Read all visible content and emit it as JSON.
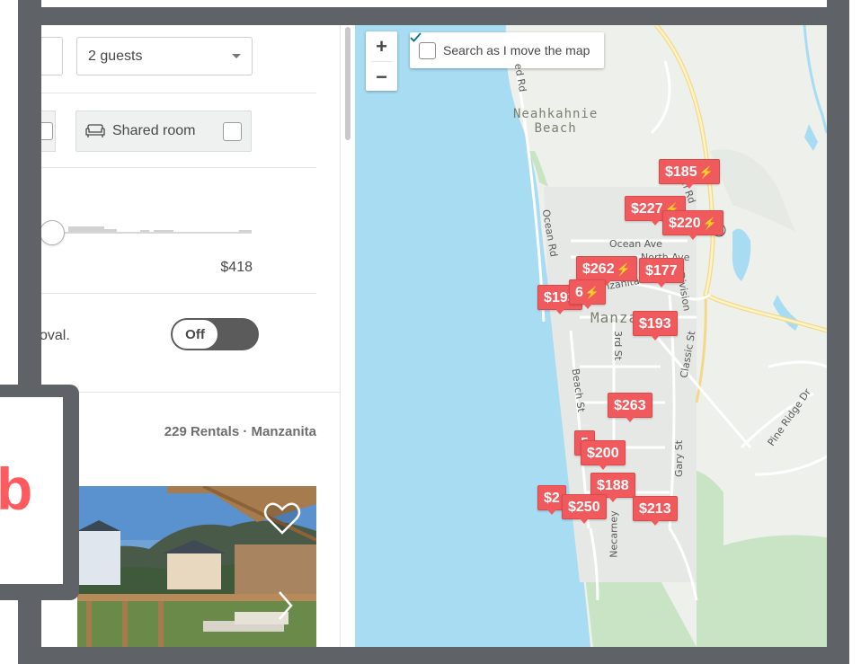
{
  "search": {
    "guests": "2 guests"
  },
  "room_types": {
    "shared_room": "Shared room"
  },
  "price": {
    "max": "$418"
  },
  "instant_book": {
    "label_fragment": "oval.",
    "toggle": "Off"
  },
  "results": {
    "count": "229 Rentals · Manzanita"
  },
  "logo": {
    "letter": "b"
  },
  "map": {
    "zoom_in": "+",
    "zoom_out": "−",
    "search_as_move": "Search as I move the map",
    "places": {
      "neahkahnie": "Neahkahnie\nBeach",
      "manzanita": "Manza"
    },
    "streets": [
      "ed Rd",
      "Ocean Rd",
      "Ocean Ave",
      "North Ave",
      "nzanita Av",
      "Division",
      "3rd St",
      "Beach St",
      "Classic St",
      "Gary St",
      "Necarney",
      "Pine Ridge Dr",
      "m Rd"
    ],
    "pins": [
      {
        "price": "$185",
        "instant": true
      },
      {
        "price": "$227",
        "instant": true
      },
      {
        "price": "$220",
        "instant": true
      },
      {
        "price": "$262",
        "instant": true
      },
      {
        "price": "$177",
        "instant": false
      },
      {
        "price": "$193",
        "instant": false
      },
      {
        "price": "6",
        "instant": true
      },
      {
        "price": "$193",
        "instant": false
      },
      {
        "price": "$263",
        "instant": false
      },
      {
        "price": "5",
        "instant": false
      },
      {
        "price": "$200",
        "instant": false
      },
      {
        "price": "$188",
        "instant": false
      },
      {
        "price": "$2",
        "instant": false
      },
      {
        "price": "$250",
        "instant": false
      },
      {
        "price": "$213",
        "instant": false
      }
    ]
  },
  "colors": {
    "brand": "#ff5a5f",
    "pin": "#f05a5d",
    "water": "#a8dcf2",
    "park": "#c9e4c5"
  }
}
